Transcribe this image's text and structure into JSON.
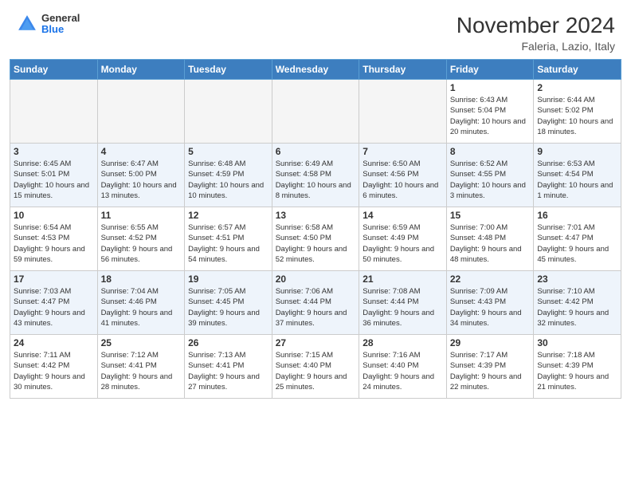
{
  "header": {
    "logo_general": "General",
    "logo_blue": "Blue",
    "month_title": "November 2024",
    "location": "Faleria, Lazio, Italy"
  },
  "days_of_week": [
    "Sunday",
    "Monday",
    "Tuesday",
    "Wednesday",
    "Thursday",
    "Friday",
    "Saturday"
  ],
  "weeks": [
    [
      {
        "day": "",
        "empty": true
      },
      {
        "day": "",
        "empty": true
      },
      {
        "day": "",
        "empty": true
      },
      {
        "day": "",
        "empty": true
      },
      {
        "day": "",
        "empty": true
      },
      {
        "day": "1",
        "sunrise": "Sunrise: 6:43 AM",
        "sunset": "Sunset: 5:04 PM",
        "daylight": "Daylight: 10 hours and 20 minutes."
      },
      {
        "day": "2",
        "sunrise": "Sunrise: 6:44 AM",
        "sunset": "Sunset: 5:02 PM",
        "daylight": "Daylight: 10 hours and 18 minutes."
      }
    ],
    [
      {
        "day": "3",
        "sunrise": "Sunrise: 6:45 AM",
        "sunset": "Sunset: 5:01 PM",
        "daylight": "Daylight: 10 hours and 15 minutes."
      },
      {
        "day": "4",
        "sunrise": "Sunrise: 6:47 AM",
        "sunset": "Sunset: 5:00 PM",
        "daylight": "Daylight: 10 hours and 13 minutes."
      },
      {
        "day": "5",
        "sunrise": "Sunrise: 6:48 AM",
        "sunset": "Sunset: 4:59 PM",
        "daylight": "Daylight: 10 hours and 10 minutes."
      },
      {
        "day": "6",
        "sunrise": "Sunrise: 6:49 AM",
        "sunset": "Sunset: 4:58 PM",
        "daylight": "Daylight: 10 hours and 8 minutes."
      },
      {
        "day": "7",
        "sunrise": "Sunrise: 6:50 AM",
        "sunset": "Sunset: 4:56 PM",
        "daylight": "Daylight: 10 hours and 6 minutes."
      },
      {
        "day": "8",
        "sunrise": "Sunrise: 6:52 AM",
        "sunset": "Sunset: 4:55 PM",
        "daylight": "Daylight: 10 hours and 3 minutes."
      },
      {
        "day": "9",
        "sunrise": "Sunrise: 6:53 AM",
        "sunset": "Sunset: 4:54 PM",
        "daylight": "Daylight: 10 hours and 1 minute."
      }
    ],
    [
      {
        "day": "10",
        "sunrise": "Sunrise: 6:54 AM",
        "sunset": "Sunset: 4:53 PM",
        "daylight": "Daylight: 9 hours and 59 minutes."
      },
      {
        "day": "11",
        "sunrise": "Sunrise: 6:55 AM",
        "sunset": "Sunset: 4:52 PM",
        "daylight": "Daylight: 9 hours and 56 minutes."
      },
      {
        "day": "12",
        "sunrise": "Sunrise: 6:57 AM",
        "sunset": "Sunset: 4:51 PM",
        "daylight": "Daylight: 9 hours and 54 minutes."
      },
      {
        "day": "13",
        "sunrise": "Sunrise: 6:58 AM",
        "sunset": "Sunset: 4:50 PM",
        "daylight": "Daylight: 9 hours and 52 minutes."
      },
      {
        "day": "14",
        "sunrise": "Sunrise: 6:59 AM",
        "sunset": "Sunset: 4:49 PM",
        "daylight": "Daylight: 9 hours and 50 minutes."
      },
      {
        "day": "15",
        "sunrise": "Sunrise: 7:00 AM",
        "sunset": "Sunset: 4:48 PM",
        "daylight": "Daylight: 9 hours and 48 minutes."
      },
      {
        "day": "16",
        "sunrise": "Sunrise: 7:01 AM",
        "sunset": "Sunset: 4:47 PM",
        "daylight": "Daylight: 9 hours and 45 minutes."
      }
    ],
    [
      {
        "day": "17",
        "sunrise": "Sunrise: 7:03 AM",
        "sunset": "Sunset: 4:47 PM",
        "daylight": "Daylight: 9 hours and 43 minutes."
      },
      {
        "day": "18",
        "sunrise": "Sunrise: 7:04 AM",
        "sunset": "Sunset: 4:46 PM",
        "daylight": "Daylight: 9 hours and 41 minutes."
      },
      {
        "day": "19",
        "sunrise": "Sunrise: 7:05 AM",
        "sunset": "Sunset: 4:45 PM",
        "daylight": "Daylight: 9 hours and 39 minutes."
      },
      {
        "day": "20",
        "sunrise": "Sunrise: 7:06 AM",
        "sunset": "Sunset: 4:44 PM",
        "daylight": "Daylight: 9 hours and 37 minutes."
      },
      {
        "day": "21",
        "sunrise": "Sunrise: 7:08 AM",
        "sunset": "Sunset: 4:44 PM",
        "daylight": "Daylight: 9 hours and 36 minutes."
      },
      {
        "day": "22",
        "sunrise": "Sunrise: 7:09 AM",
        "sunset": "Sunset: 4:43 PM",
        "daylight": "Daylight: 9 hours and 34 minutes."
      },
      {
        "day": "23",
        "sunrise": "Sunrise: 7:10 AM",
        "sunset": "Sunset: 4:42 PM",
        "daylight": "Daylight: 9 hours and 32 minutes."
      }
    ],
    [
      {
        "day": "24",
        "sunrise": "Sunrise: 7:11 AM",
        "sunset": "Sunset: 4:42 PM",
        "daylight": "Daylight: 9 hours and 30 minutes."
      },
      {
        "day": "25",
        "sunrise": "Sunrise: 7:12 AM",
        "sunset": "Sunset: 4:41 PM",
        "daylight": "Daylight: 9 hours and 28 minutes."
      },
      {
        "day": "26",
        "sunrise": "Sunrise: 7:13 AM",
        "sunset": "Sunset: 4:41 PM",
        "daylight": "Daylight: 9 hours and 27 minutes."
      },
      {
        "day": "27",
        "sunrise": "Sunrise: 7:15 AM",
        "sunset": "Sunset: 4:40 PM",
        "daylight": "Daylight: 9 hours and 25 minutes."
      },
      {
        "day": "28",
        "sunrise": "Sunrise: 7:16 AM",
        "sunset": "Sunset: 4:40 PM",
        "daylight": "Daylight: 9 hours and 24 minutes."
      },
      {
        "day": "29",
        "sunrise": "Sunrise: 7:17 AM",
        "sunset": "Sunset: 4:39 PM",
        "daylight": "Daylight: 9 hours and 22 minutes."
      },
      {
        "day": "30",
        "sunrise": "Sunrise: 7:18 AM",
        "sunset": "Sunset: 4:39 PM",
        "daylight": "Daylight: 9 hours and 21 minutes."
      }
    ]
  ]
}
